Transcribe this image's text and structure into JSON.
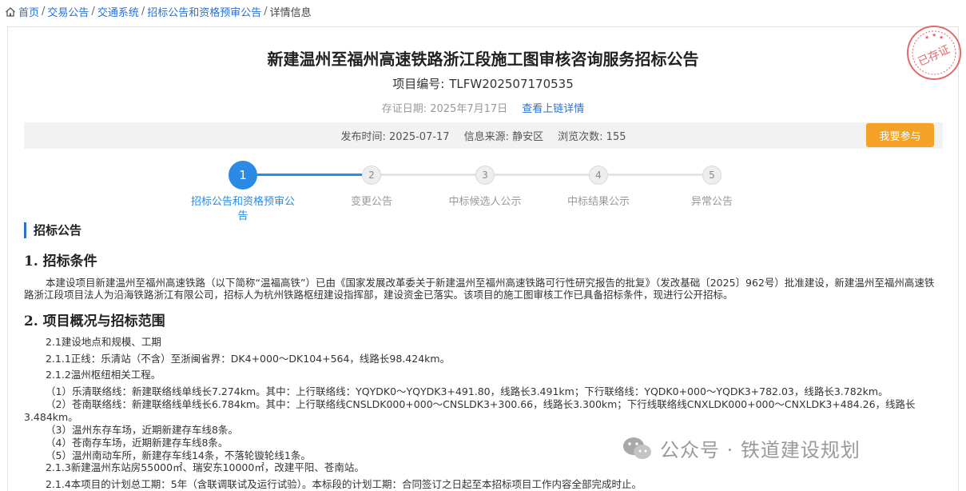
{
  "breadcrumb": {
    "home": "首页",
    "trade": "交易公告",
    "system": "交通系统",
    "notice": "招标公告和资格预审公告",
    "current": "详情信息"
  },
  "header": {
    "title": "新建温州至福州高速铁路浙江段施工图审核咨询服务招标公告",
    "project_no_label": "项目编号:",
    "project_no": "TLFW202507170535",
    "deposit_label": "存证日期:",
    "deposit_date": "2025年7月17日",
    "chain_link": "查看上链详情",
    "stamp_text": "已存证"
  },
  "info": {
    "publish_label": "发布时间:",
    "publish_date": "2025-07-17",
    "source_label": "信息来源:",
    "source": "静安区",
    "views_label": "浏览次数:",
    "views": "155",
    "join_button": "我要参与"
  },
  "steps": [
    {
      "num": "1",
      "label": "招标公告和资格预审公\n告",
      "active": true
    },
    {
      "num": "2",
      "label": "变更公告",
      "active": false
    },
    {
      "num": "3",
      "label": "中标候选人公示",
      "active": false
    },
    {
      "num": "4",
      "label": "中标结果公示",
      "active": false
    },
    {
      "num": "5",
      "label": "异常公告",
      "active": false
    }
  ],
  "content": {
    "section_title": "招标公告",
    "h1": "1.  招标条件",
    "p1": "本建设项目新建温州至福州高速铁路（以下简称“温福高铁”）已由《国家发展改革委关于新建温州至福州高速铁路可行性研究报告的批复》（发改基础〔2025〕962号）批准建设，新建温州至福州高速铁路浙江段项目法人为沿海铁路浙江有限公司，招标人为杭州铁路枢纽建设指挥部，建设资金已落实。该项目的施工图审核工作已具备招标条件，现进行公开招标。",
    "h2": "2.  项目概况与招标范围",
    "l1": "2.1建设地点和规模、工期",
    "l2": "2.1.1正线：乐清站（不含）至浙闽省界：DK4+000～DK104+564，线路长98.424km。",
    "l3": "2.1.2温州枢纽相关工程。",
    "l4": "（1）乐清联络线：新建联络线单线长7.274km。其中：上行联络线：YQYDK0～YQYDK3+491.80，线路长3.491km；下行联络线：YQDK0+000～YQDK3+782.03，线路长3.782km。",
    "l5a": "（2）苍南联络线：新建联络线单线长6.784km。其中：上行联络线CNSLDK000+000～CNSLDK3+300.66，线路长3.300km；下行线联络线CNXLDK000+000～CNXLDK3+484.26，线路长",
    "l5b": "3.484km。",
    "l6": "（3）温州东存车场，近期新建存车线8条。",
    "l7": "（4）苍南存车场，近期新建存车线8条。",
    "l8": "（5）温州南动车所，新建存车线14条，不落轮镟轮线1条。",
    "l9": "2.1.3新建温州东站房55000㎡、瑞安东10000㎡，改建平阳、苍南站。",
    "l10": "2.1.4本项目的计划总工期：5年（含联调联试及运行试验）。本标段的计划工期：合同签订之日起至本招标项目工作内容全部完成时止。"
  },
  "watermark": {
    "text": "公众号 · 铁道建设规划"
  }
}
